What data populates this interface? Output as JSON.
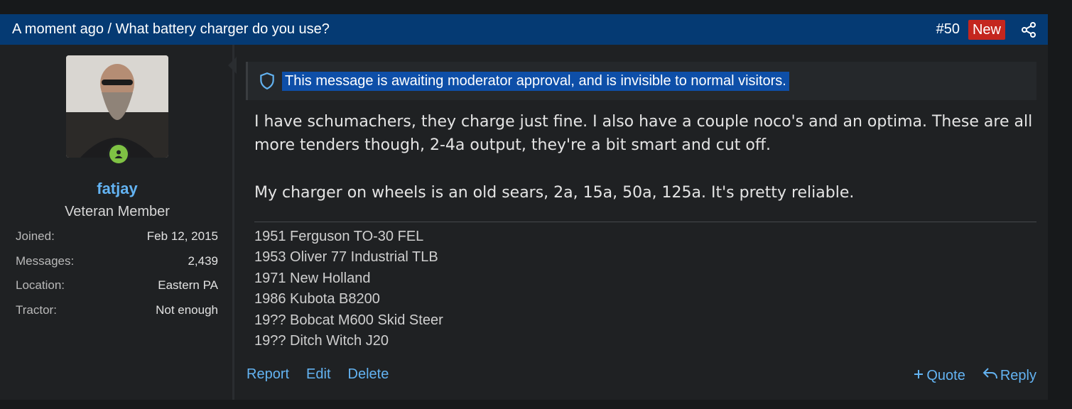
{
  "header": {
    "breadcrumb": "A moment ago / What battery charger do you use?",
    "post_number": "#50",
    "new_badge": "New",
    "share_icon": "share-icon"
  },
  "user": {
    "username": "fatjay",
    "title": "Veteran Member",
    "online_icon": "user-online-icon",
    "stats": [
      {
        "label": "Joined:",
        "value": "Feb 12, 2015"
      },
      {
        "label": "Messages:",
        "value": "2,439"
      },
      {
        "label": "Location:",
        "value": "Eastern PA"
      },
      {
        "label": "Tractor:",
        "value": "Not enough"
      }
    ]
  },
  "notice": {
    "icon": "shield-icon",
    "text": "This message is awaiting moderator approval, and is invisible to normal visitors."
  },
  "message": {
    "paragraphs": [
      "I have schumachers, they charge just fine. I also have a couple noco's and an optima. These are all more tenders though, 2-4a output, they're a bit smart and cut off.",
      "My charger on wheels is an old sears, 2a, 15a, 50a, 125a. It's pretty reliable."
    ]
  },
  "signature": {
    "lines": [
      "1951 Ferguson TO-30 FEL",
      "1953 Oliver 77 Industrial TLB",
      "1971 New Holland",
      "1986 Kubota B8200",
      "19?? Bobcat M600 Skid Steer",
      "19?? Ditch Witch J20"
    ]
  },
  "actions": {
    "report": "Report",
    "edit": "Edit",
    "delete": "Delete",
    "quote": "Quote",
    "reply": "Reply"
  },
  "colors": {
    "header_bg": "#053a73",
    "new_badge": "#c4261e",
    "link": "#63b3f2",
    "online": "#7fc244",
    "highlight": "#0e4fa8"
  }
}
